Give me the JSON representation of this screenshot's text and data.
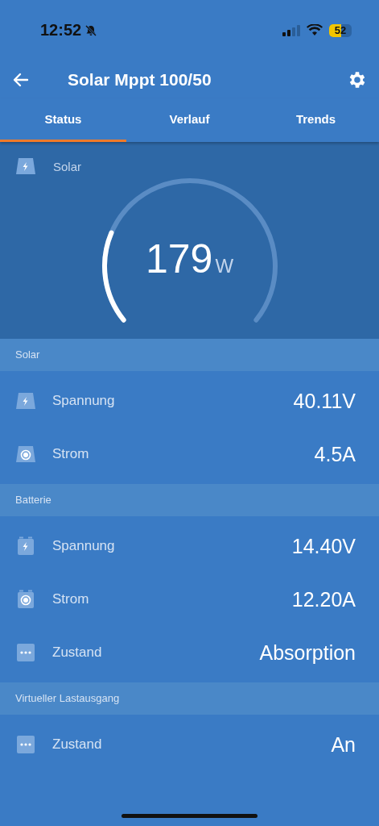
{
  "status_bar": {
    "time": "12:52",
    "battery": "52"
  },
  "header": {
    "title": "Solar Mppt 100/50"
  },
  "tabs": [
    {
      "label": "Status",
      "selected": true
    },
    {
      "label": "Verlauf",
      "selected": false
    },
    {
      "label": "Trends",
      "selected": false
    }
  ],
  "gauge": {
    "label": "Solar",
    "value": "179",
    "unit": "W"
  },
  "sections": [
    {
      "title": "Solar",
      "rows": [
        {
          "kind": "panel-bolt",
          "label": "Spannung",
          "value": "40.11V"
        },
        {
          "kind": "panel-current",
          "label": "Strom",
          "value": "4.5A"
        }
      ]
    },
    {
      "title": "Batterie",
      "rows": [
        {
          "kind": "battery-bolt",
          "label": "Spannung",
          "value": "14.40V"
        },
        {
          "kind": "battery-current",
          "label": "Strom",
          "value": "12.20A"
        },
        {
          "kind": "dots",
          "label": "Zustand",
          "value": "Absorption"
        }
      ]
    },
    {
      "title": "Virtueller Lastausgang",
      "rows": [
        {
          "kind": "dots",
          "label": "Zustand",
          "value": "An"
        }
      ]
    }
  ]
}
